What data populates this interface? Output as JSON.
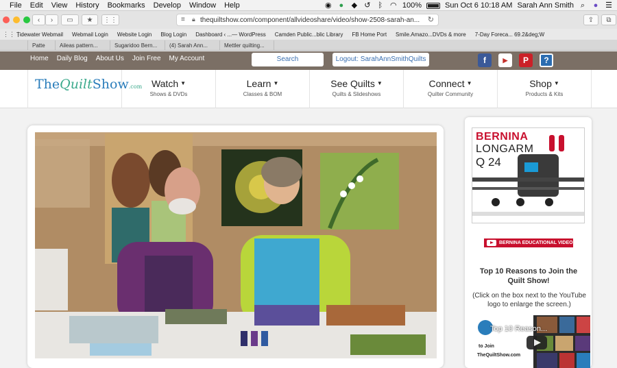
{
  "menubar": {
    "items": [
      "File",
      "Edit",
      "View",
      "History",
      "Bookmarks",
      "Develop",
      "Window",
      "Help"
    ],
    "battery": "100%",
    "datetime": "Sun Oct 6  10:18 AM",
    "user": "Sarah Ann Smith"
  },
  "toolbar": {
    "url": "thequiltshow.com/component/allvideoshare/video/show-2508-sarah-an..."
  },
  "bookmarks": [
    "Tidewater Webmail",
    "Webmail Login",
    "Website Login",
    "Blog Login",
    "Dashboard ‹ ...— WordPress",
    "Camden Public...blic Library",
    "FB Home Port",
    "Smile.Amazo...DVDs & more",
    "7-Day Foreca... 69.2&deg;W"
  ],
  "tabs": [
    "Patte",
    "Aileas pattern...",
    "Sugaridoo Bern...",
    "(4) Sarah Ann...",
    "Mettler quilting..."
  ],
  "sitenav": {
    "links": [
      "Home",
      "Daily Blog",
      "About Us",
      "Join Free",
      "My Account"
    ],
    "search_label": "Search",
    "logout_label": "Logout: SarahAnnSmithQuilts",
    "social_icons": [
      "facebook-icon",
      "youtube-icon",
      "pinterest-icon",
      "help-icon"
    ]
  },
  "logo": {
    "the": "The",
    "quilt": "Quilt",
    "show": "Show",
    "com": ".com"
  },
  "menu": [
    {
      "title": "Watch",
      "sub": "Shows & DVDs"
    },
    {
      "title": "Learn",
      "sub": "Classes & BOM"
    },
    {
      "title": "See Quilts",
      "sub": "Quilts & Slideshows"
    },
    {
      "title": "Connect",
      "sub": "Quilter Community"
    },
    {
      "title": "Shop",
      "sub": "Products & Kits"
    }
  ],
  "sidebar": {
    "ad_brand": "BERNINA",
    "ad_line2": "LONGARM",
    "ad_line3": "Q 24",
    "edu_banner": "BERNINA EDUCATIONAL VIDEOS",
    "reasons_title": "Top 10 Reasons to Join the Quilt Show!",
    "reasons_note": "(Click on the box next to the YouTube logo to enlarge the screen.)",
    "yt_title": "Top 10 Reason...",
    "yt_tojoin": "to Join",
    "yt_site": "TheQuiltShow.com"
  },
  "colors": {
    "nav_brown": "#7b6f65",
    "link_blue": "#3a6fb0",
    "bernina_red": "#c8102e",
    "logo_blue": "#2a7dbb",
    "logo_green": "#3aa98b"
  }
}
